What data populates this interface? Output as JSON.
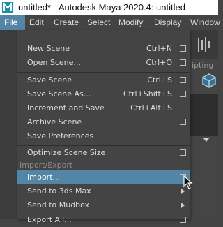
{
  "window": {
    "title": "untitled* - Autodesk Maya 2020.4: untitled"
  },
  "menubar": [
    {
      "label": "File",
      "active": true
    },
    {
      "label": "Edit"
    },
    {
      "label": "Create"
    },
    {
      "label": "Select"
    },
    {
      "label": "Modify"
    },
    {
      "label": "Display"
    },
    {
      "label": "Window"
    }
  ],
  "right_panel": {
    "partial_label": "ipting"
  },
  "file_menu": {
    "items": [
      {
        "label": "New Scene",
        "shortcut": "Ctrl+N",
        "option_box": true
      },
      {
        "label": "Open Scene...",
        "shortcut": "Ctrl+O",
        "option_box": true
      },
      {
        "label": "Save Scene",
        "shortcut": "Ctrl+S",
        "option_box": true
      },
      {
        "label": "Save Scene As...",
        "shortcut": "Ctrl+Shift+S",
        "option_box": true
      },
      {
        "label": "Increment and Save",
        "shortcut": "Ctrl+Alt+S",
        "option_box": false
      },
      {
        "label": "Archive Scene",
        "shortcut": "",
        "option_box": true
      },
      {
        "label": "Save Preferences",
        "shortcut": "",
        "option_box": false
      },
      {
        "label": "Optimize Scene Size",
        "shortcut": "",
        "option_box": true
      },
      {
        "label": "Import...",
        "shortcut": "",
        "option_box": true,
        "highlighted": true
      },
      {
        "label": "Send to 3ds Max",
        "shortcut": "",
        "submenu": true
      },
      {
        "label": "Send to Mudbox",
        "shortcut": "",
        "submenu": true
      },
      {
        "label": "Export All...",
        "shortcut": "",
        "option_box": true
      }
    ],
    "section_label": "Import/Export"
  },
  "colors": {
    "highlight": "#5285a6",
    "menu_bg": "#444444"
  }
}
